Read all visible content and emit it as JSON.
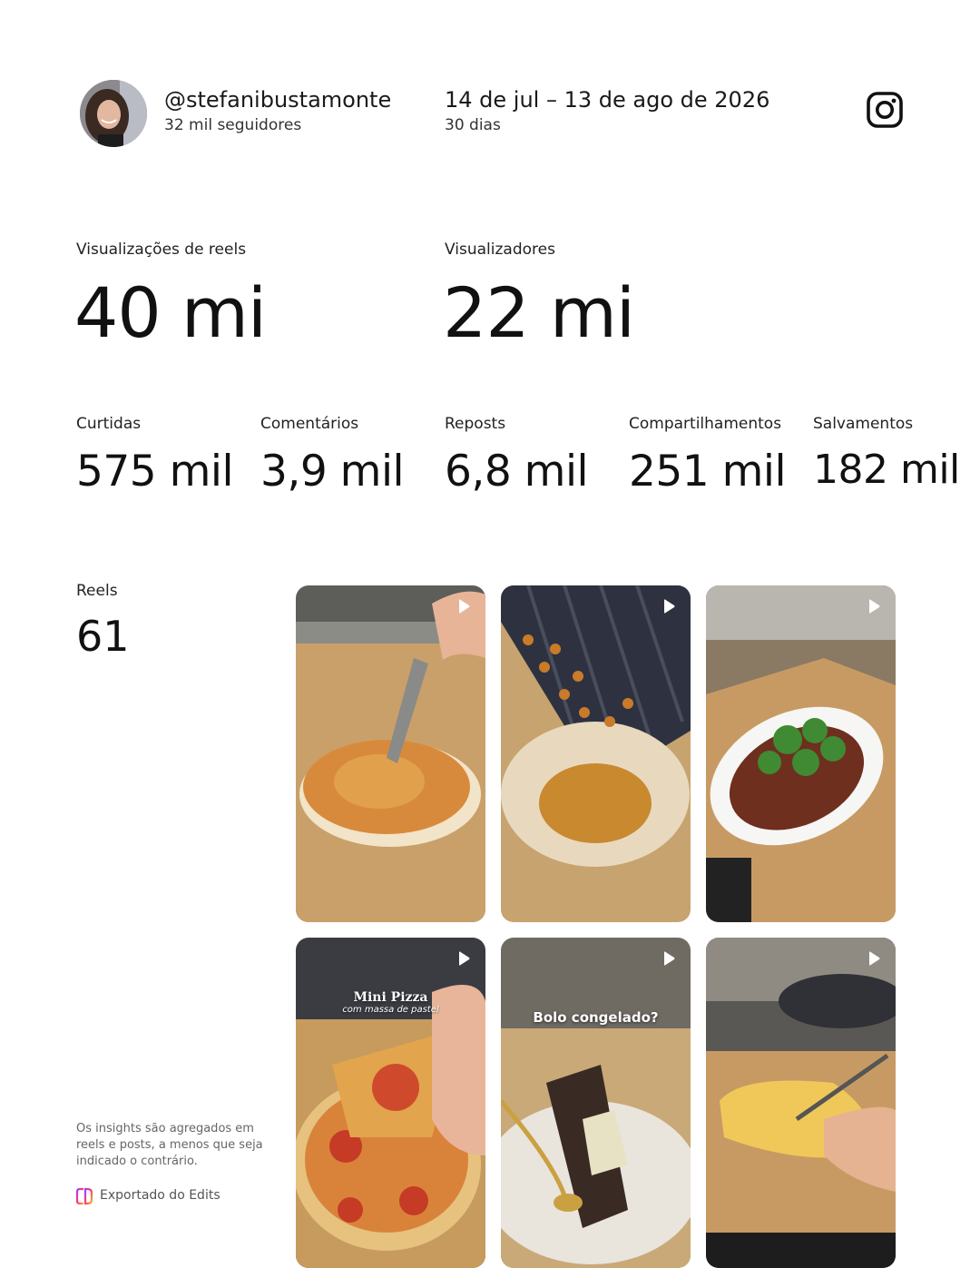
{
  "profile": {
    "handle": "@stefanibustamonte",
    "followers": "32 mil seguidores"
  },
  "period": {
    "range": "14 de jul – 13 de ago de 2026",
    "days": "30 dias"
  },
  "platform_icon": "instagram-icon",
  "primary_metrics": [
    {
      "label": "Visualizações de reels",
      "value": "40 mi"
    },
    {
      "label": "Visualizadores",
      "value": "22 mi"
    }
  ],
  "secondary_metrics": [
    {
      "label": "Curtidas",
      "value": "575 mil"
    },
    {
      "label": "Comentários",
      "value": "3,9 mil"
    },
    {
      "label": "Reposts",
      "value": "6,8 mil"
    },
    {
      "label": "Compartilhamentos",
      "value": "251 mil"
    },
    {
      "label": "Salvamentos",
      "value": "182 mil"
    }
  ],
  "reels": {
    "label": "Reels",
    "count": "61",
    "thumbnails": [
      {
        "scene": "pizza-cutting",
        "overlay_title": "",
        "overlay_subtitle": ""
      },
      {
        "scene": "roasted-chickpeas",
        "overlay_title": "",
        "overlay_subtitle": ""
      },
      {
        "scene": "ground-beef-broccoli",
        "overlay_title": "",
        "overlay_subtitle": ""
      },
      {
        "scene": "mini-pizza-slice",
        "overlay_title": "Mini Pizza",
        "overlay_subtitle": "com massa de pastel"
      },
      {
        "scene": "frozen-cake",
        "overlay_title": "Bolo congelado?",
        "overlay_subtitle": ""
      },
      {
        "scene": "folded-omelette",
        "overlay_title": "",
        "overlay_subtitle": ""
      }
    ]
  },
  "footer": {
    "note": "Os insights são agregados em reels e posts, a menos que seja indicado o contrário.",
    "export_label": "Exportado do Edits"
  },
  "colors": {
    "text": "#111111",
    "muted": "#666666",
    "edits_gradient": [
      "#a63bff",
      "#ff3d6e",
      "#ffb02e"
    ]
  }
}
